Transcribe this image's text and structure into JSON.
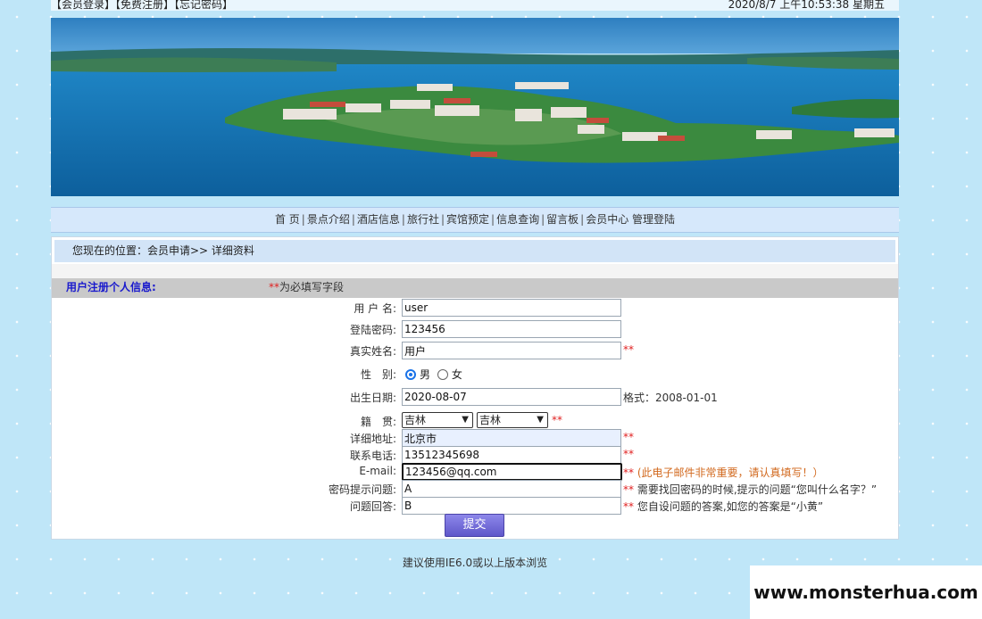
{
  "topbar": {
    "login": "【会员登录】",
    "register": "【免费注册】",
    "forgot": "【忘记密码】",
    "datetime": "2020/8/7 上午10:53:38  星期五"
  },
  "nav": {
    "items": [
      "首 页",
      "景点介绍",
      "酒店信息",
      "旅行社",
      "宾馆预定",
      "信息查询",
      "留言板",
      "会员中心",
      "管理登陆"
    ]
  },
  "breadcrumb": "您现在的位置：会员申请>> 详细资料",
  "form": {
    "section_title": "用户注册个人信息:",
    "required_marker": "**",
    "required_note": "为必填写字段",
    "username": {
      "label": "用 户 名:",
      "value": "user"
    },
    "password": {
      "label": "登陆密码:",
      "value": "123456"
    },
    "realname": {
      "label": "真实姓名:",
      "value": "用户",
      "mark": "**"
    },
    "gender": {
      "label": "性　别:",
      "options": [
        "男",
        "女"
      ],
      "selected": "男"
    },
    "birthday": {
      "label": "出生日期:",
      "value": "2020-08-07",
      "hint": "格式：2008-01-01"
    },
    "native": {
      "label": "籍　贯:",
      "province": "吉林",
      "city": "吉林",
      "mark": "**"
    },
    "address": {
      "label": "详细地址:",
      "value": "北京市",
      "mark": "**"
    },
    "phone": {
      "label": "联系电话:",
      "value": "13512345698",
      "mark": "**"
    },
    "email": {
      "label": "E-mail:",
      "value": "123456@qq.com",
      "mark": "**",
      "hint": "(此电子邮件非常重要，请认真填写！）"
    },
    "question": {
      "label": "密码提示问题:",
      "value": "A",
      "mark": "**",
      "hint": "需要找回密码的时候,提示的问题“您叫什么名字？”"
    },
    "answer": {
      "label": "问题回答:",
      "value": "B",
      "mark": "**",
      "hint": "您自设问题的答案,如您的答案是“小黄”"
    },
    "submit_label": "提交"
  },
  "footer": "建议使用IE6.0或以上版本浏览",
  "watermark": "www.monsterhua.com",
  "colors": {
    "accent": "#1a1acd",
    "required": "#e02020",
    "button": "#6b63d6"
  }
}
